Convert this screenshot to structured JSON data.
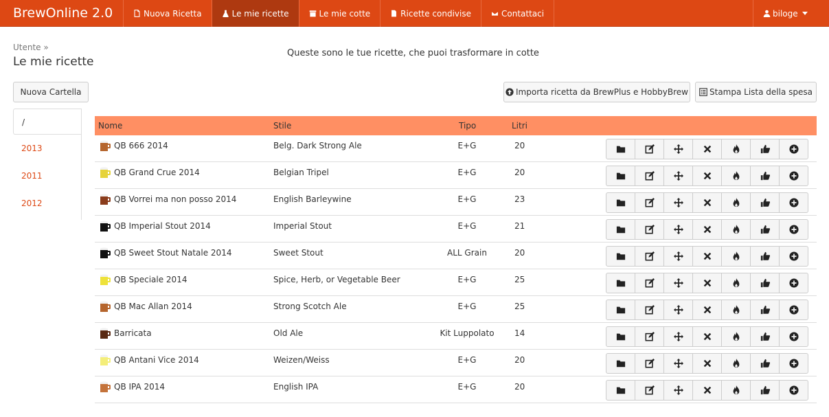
{
  "navbar": {
    "brand": "BrewOnline 2.0",
    "items": [
      {
        "label": "Nuova Ricetta",
        "icon": "file-icon",
        "active": false
      },
      {
        "label": "Le mie ricette",
        "icon": "flask-icon",
        "active": true
      },
      {
        "label": "Le mie cotte",
        "icon": "folder-icon",
        "active": false
      },
      {
        "label": "Ricette condivise",
        "icon": "file-share-icon",
        "active": false
      },
      {
        "label": "Contattaci",
        "icon": "envelope-icon",
        "active": false
      }
    ],
    "user": "biloge"
  },
  "header": {
    "breadcrumb": "Utente »",
    "title": "Le mie ricette",
    "lead": "Queste sono le tue ricette, che puoi trasformare in cotte"
  },
  "toolbar": {
    "new_folder": "Nuova Cartella",
    "import": "Importa ricetta da BrewPlus e HobbyBrew",
    "shopping_list": "Stampa Lista della spesa"
  },
  "folders": {
    "root": "/",
    "items": [
      "2013",
      "2011",
      "2012"
    ]
  },
  "table": {
    "headers": {
      "name": "Nome",
      "style": "Stile",
      "type": "Tipo",
      "liters": "Litri"
    },
    "rows": [
      {
        "name": "QB 666 2014",
        "style": "Belg. Dark Strong Ale",
        "type": "E+G",
        "liters": "20",
        "color": "#b5652d"
      },
      {
        "name": "QB Grand Crue 2014",
        "style": "Belgian Tripel",
        "type": "E+G",
        "liters": "20",
        "color": "#e6d33a"
      },
      {
        "name": "QB Vorrei ma non posso 2014",
        "style": "English Barleywine",
        "type": "E+G",
        "liters": "23",
        "color": "#8b3d1c"
      },
      {
        "name": "QB Imperial Stout 2014",
        "style": "Imperial Stout",
        "type": "E+G",
        "liters": "21",
        "color": "#111111"
      },
      {
        "name": "QB Sweet Stout Natale 2014",
        "style": "Sweet Stout",
        "type": "ALL Grain",
        "liters": "20",
        "color": "#111111"
      },
      {
        "name": "QB Speciale 2014",
        "style": "Spice, Herb, or Vegetable Beer",
        "type": "E+G",
        "liters": "25",
        "color": "#eee23a"
      },
      {
        "name": "QB Mac Allan 2014",
        "style": "Strong Scotch Ale",
        "type": "E+G",
        "liters": "25",
        "color": "#b5652d"
      },
      {
        "name": "Barricata",
        "style": "Old Ale",
        "type": "Kit Luppolato",
        "liters": "14",
        "color": "#5a2a12"
      },
      {
        "name": "QB Antani Vice 2014",
        "style": "Weizen/Weiss",
        "type": "E+G",
        "liters": "20",
        "color": "#f4ee7a"
      },
      {
        "name": "QB IPA 2014",
        "style": "English IPA",
        "type": "E+G",
        "liters": "20",
        "color": "#c4733b"
      }
    ],
    "row_actions": [
      "folder-icon",
      "edit-icon",
      "move-icon",
      "delete-icon",
      "fire-icon",
      "thumbs-up-icon",
      "plus-circle-icon"
    ]
  }
}
